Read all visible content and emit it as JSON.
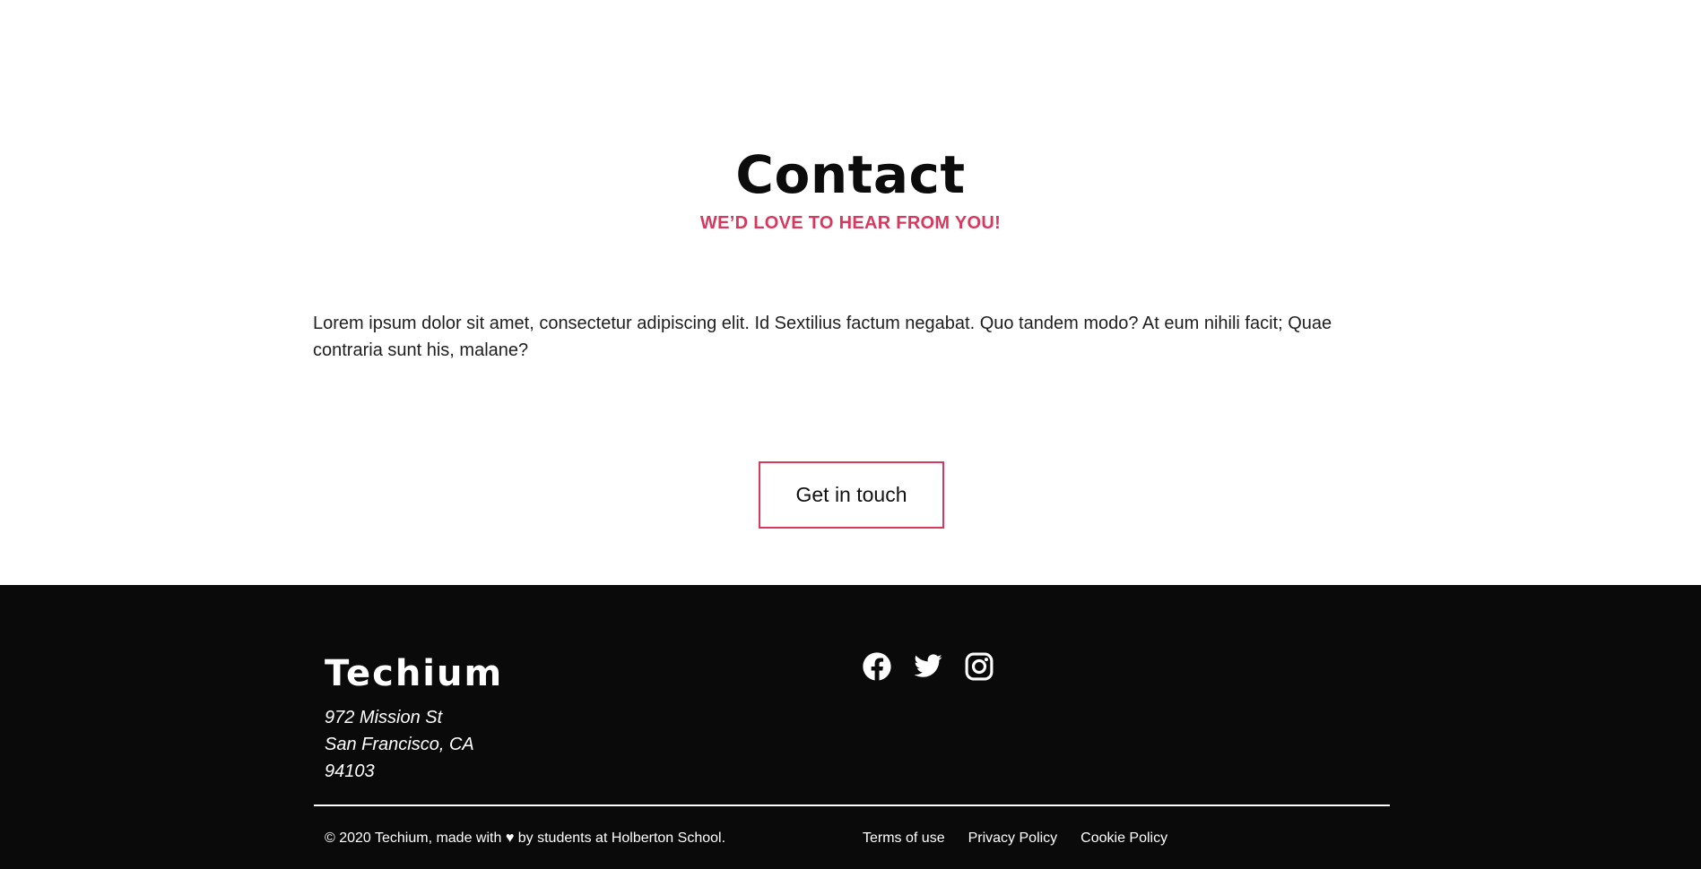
{
  "contact": {
    "title": "Contact",
    "subtitle": "WE’D LOVE TO HEAR FROM YOU!",
    "text": "Lorem ipsum dolor sit amet, consectetur adipiscing elit. Id Sextilius factum negabat. Quo tandem modo? At eum nihili facit; Quae contraria sunt his, malane?",
    "button_label": "Get in touch"
  },
  "footer": {
    "brand": "Techium",
    "address": [
      "972 Mission St",
      "San Francisco, CA",
      "94103"
    ],
    "social": [
      "facebook-icon",
      "twitter-icon",
      "instagram-icon"
    ],
    "copyright": "© 2020 Techium, made with ♥ by students at Holberton School.",
    "links": [
      "Terms of use",
      "Privacy Policy",
      "Cookie Policy"
    ]
  },
  "colors": {
    "accent": "#d7385e",
    "footer_bg": "#0a0a0a",
    "text": "#1e1e1e"
  }
}
